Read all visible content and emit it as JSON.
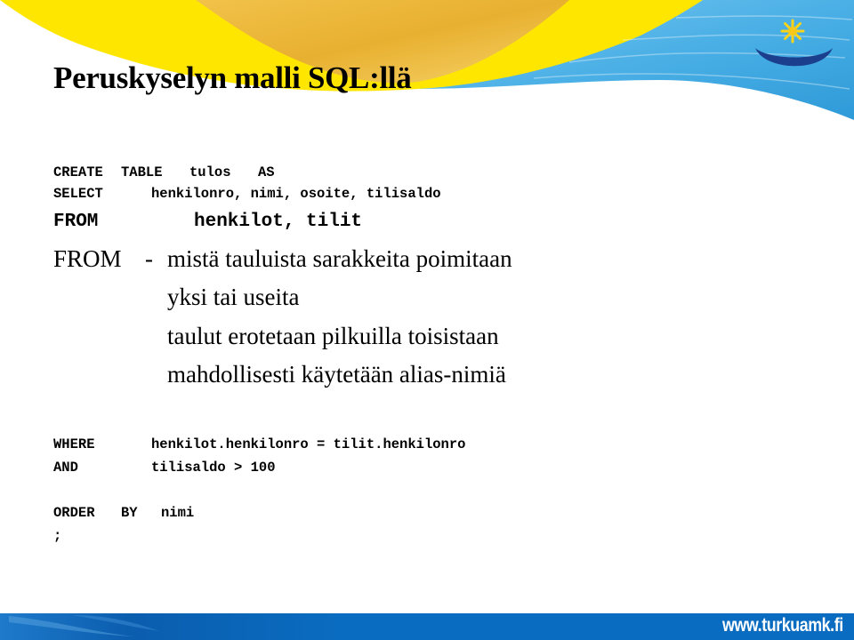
{
  "slide": {
    "title": "Peruskyselyn malli SQL:llä",
    "sql_top": {
      "create_kw": "CREATE",
      "table_kw": "TABLE",
      "table_name": "tulos",
      "as_kw": "AS",
      "select_kw": "SELECT",
      "select_cols": "henkilonro, nimi, osoite, tilisaldo",
      "from_kw": "FROM",
      "from_tables": "henkilot, tilit"
    },
    "explanation": {
      "heading": "FROM",
      "dash": "-",
      "lines": [
        "mistä tauluista sarakkeita poimitaan",
        "yksi tai useita",
        "taulut erotetaan pilkuilla toisistaan",
        "mahdollisesti käytetään alias-nimiä"
      ]
    },
    "sql_bottom": {
      "where_kw": "WHERE",
      "where_cond": "henkilot.henkilonro = tilit.henkilonro",
      "and_kw": "AND",
      "and_cond": "tilisaldo > 100",
      "order_kw": "ORDER",
      "by_kw": "BY",
      "order_col": "nimi",
      "terminator": ";"
    }
  },
  "branding": {
    "footer_url": "www.turkuamk.fi",
    "logo_icon": "sun-smile-logo-icon",
    "colors": {
      "yellow": "#FFE600",
      "sky_blue": "#4DB3E8",
      "navy": "#1B3F8C",
      "footer_blue": "#0A6CC0"
    }
  }
}
